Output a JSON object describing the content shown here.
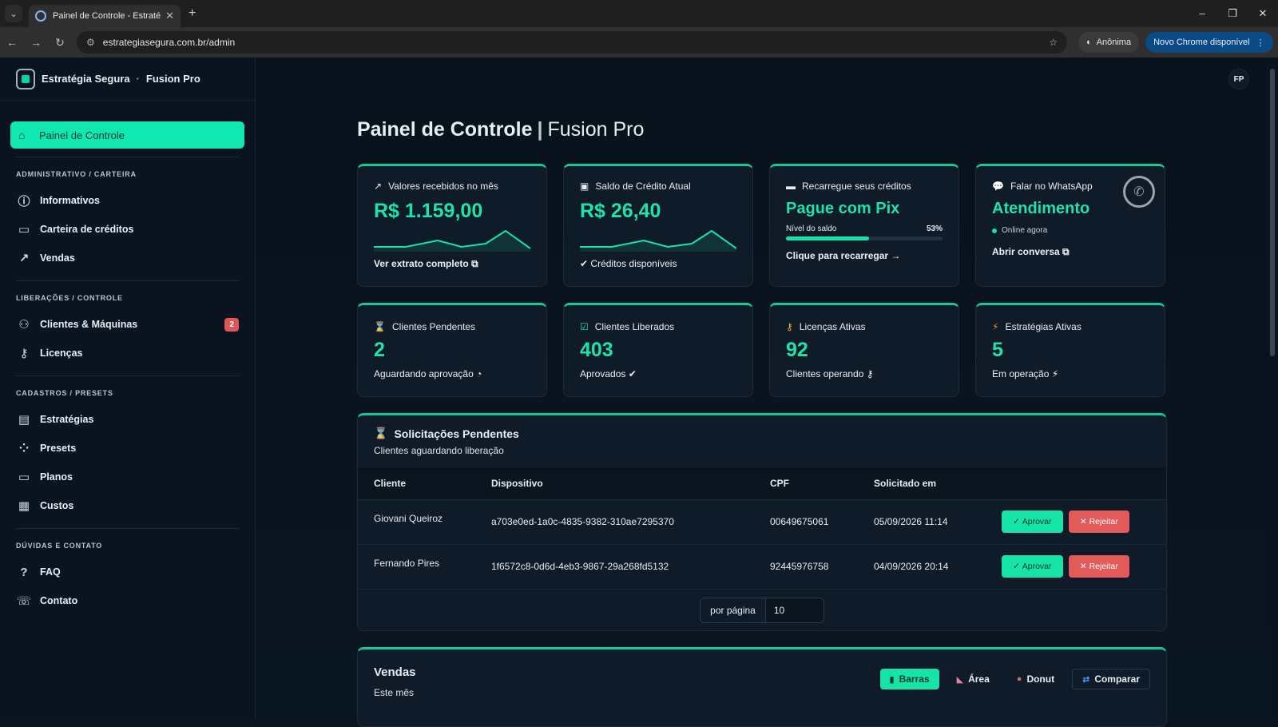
{
  "browser": {
    "tab_title": "Painel de Controle - Estratégia Segura",
    "url": "estrategiasegura.com.br/admin",
    "incognito_label": "Anônima",
    "update_label": "Novo Chrome disponível"
  },
  "brand": {
    "name": "Estratégia Segura",
    "separator": "·",
    "product": "Fusion Pro"
  },
  "user": {
    "initials": "FP"
  },
  "sidebar": {
    "active": {
      "label": "Painel de Controle",
      "icon": "home-icon"
    },
    "sections": [
      {
        "title": "ADMINISTRATIVO / CARTEIRA",
        "items": [
          {
            "label": "Informativos",
            "icon": "info-icon"
          },
          {
            "label": "Carteira de créditos",
            "icon": "wallet-icon"
          },
          {
            "label": "Vendas",
            "icon": "trend-icon"
          }
        ]
      },
      {
        "title": "LIBERAÇÕES / CONTROLE",
        "items": [
          {
            "label": "Clientes & Máquinas",
            "icon": "users-icon",
            "badge": "2"
          },
          {
            "label": "Licenças",
            "icon": "key-icon"
          }
        ]
      },
      {
        "title": "CADASTROS / PRESETS",
        "items": [
          {
            "label": "Estratégias",
            "icon": "archive-icon"
          },
          {
            "label": "Presets",
            "icon": "grid-icon"
          },
          {
            "label": "Planos",
            "icon": "card-icon"
          },
          {
            "label": "Custos",
            "icon": "calc-icon"
          }
        ]
      },
      {
        "title": "DÚVIDAS E CONTATO",
        "items": [
          {
            "label": "FAQ",
            "icon": "help-icon"
          },
          {
            "label": "Contato",
            "icon": "chat-icon"
          }
        ]
      }
    ]
  },
  "page": {
    "title": "Painel de Controle",
    "subtitle": "Fusion Pro"
  },
  "cards": {
    "received": {
      "label": "Valores recebidos no mês",
      "value": "R$ 1.159,00",
      "link": "Ver extrato completo"
    },
    "balance": {
      "label": "Saldo de Crédito Atual",
      "value": "R$ 26,40",
      "foot": "Créditos disponíveis"
    },
    "recharge": {
      "label": "Recarregue seus créditos",
      "value": "Pague com Pix",
      "level_label": "Nível do saldo",
      "level_text": "53%",
      "level": 53,
      "link": "Clique para recarregar"
    },
    "whatsapp": {
      "label": "Falar no WhatsApp",
      "value": "Atendimento",
      "status": "Online agora",
      "link": "Abrir conversa"
    },
    "pending": {
      "label": "Clientes Pendentes",
      "value": "2",
      "foot": "Aguardando aprovação"
    },
    "released": {
      "label": "Clientes Liberados",
      "value": "403",
      "foot": "Aprovados"
    },
    "licenses": {
      "label": "Licenças Ativas",
      "value": "92",
      "foot": "Clientes operando"
    },
    "strategies": {
      "label": "Estratégias Ativas",
      "value": "5",
      "foot": "Em operação"
    }
  },
  "requests": {
    "title": "Solicitações Pendentes",
    "subtitle": "Clientes aguardando liberação",
    "columns": [
      "Cliente",
      "Dispositivo",
      "CPF",
      "Solicitado em"
    ],
    "approve_label": "Aprovar",
    "reject_label": "Rejeitar",
    "rows": [
      {
        "cliente": "Giovani Queiroz",
        "dispositivo": "a703e0ed-1a0c-4835-9382-310ae7295370",
        "cpf": "00649675061",
        "data": "05/09/2026 11:14"
      },
      {
        "cliente": "Fernando Pires",
        "dispositivo": "1f6572c8-0d6d-4eb3-9867-29a268fd5132",
        "cpf": "92445976758",
        "data": "04/09/2026 20:14"
      }
    ],
    "per_page_label": "por página",
    "per_page_value": "10"
  },
  "sales": {
    "title": "Vendas",
    "subtitle": "Este mês",
    "tabs": [
      {
        "label": "Barras",
        "icon": "bar-chart-icon"
      },
      {
        "label": "Área",
        "icon": "area-chart-icon"
      },
      {
        "label": "Donut",
        "icon": "donut-icon"
      },
      {
        "label": "Comparar",
        "icon": "compare-icon"
      }
    ]
  },
  "colors": {
    "accent": "#15e3a8",
    "danger": "#e25a5a",
    "background": "#0b1420"
  }
}
